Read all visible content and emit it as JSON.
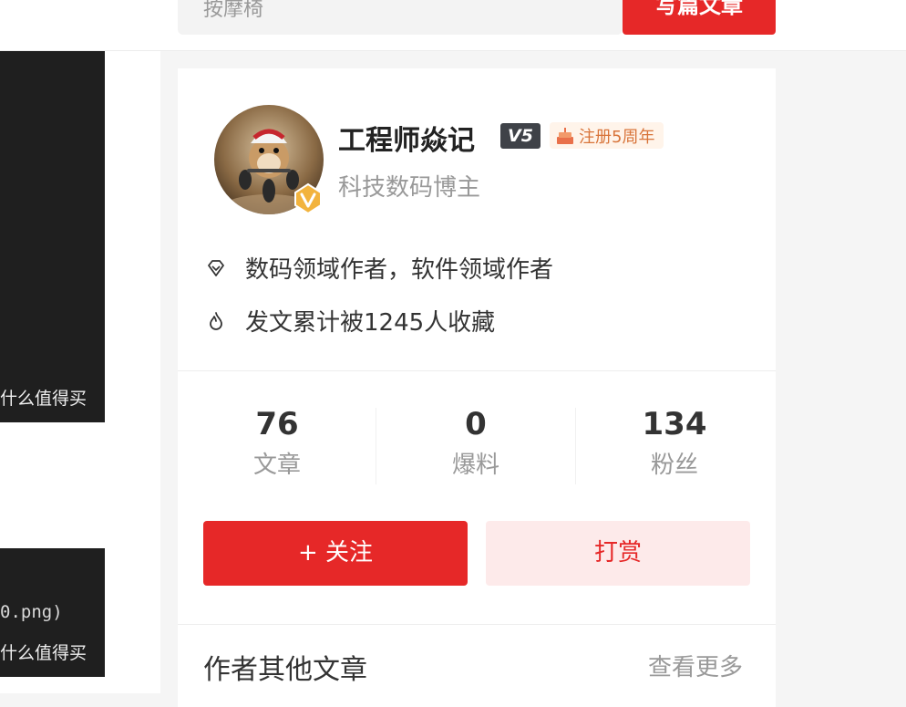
{
  "header": {
    "search_text": "按摩椅",
    "write_button": "写篇文章"
  },
  "left_images": {
    "watermark_1": "什么值得买",
    "code_snippet": "0.png)",
    "watermark_2": "什么值得买"
  },
  "author": {
    "name": "工程师焱记",
    "level": "V5",
    "anniversary": "注册5周年",
    "title": "科技数码博主",
    "info": [
      {
        "icon": "diamond-icon",
        "text": "数码领域作者，软件领域作者"
      },
      {
        "icon": "flame-icon",
        "text": "发文累计被1245人收藏"
      }
    ],
    "stats": [
      {
        "value": "76",
        "label": "文章"
      },
      {
        "value": "0",
        "label": "爆料"
      },
      {
        "value": "134",
        "label": "粉丝"
      }
    ],
    "follow_button": "+ 关注",
    "tip_button": "打赏"
  },
  "other_articles": {
    "title": "作者其他文章",
    "more_link": "查看更多"
  },
  "colors": {
    "brand_red": "#e62828",
    "tip_bg": "#fdeaea",
    "badge_orange": "#d8743a"
  }
}
